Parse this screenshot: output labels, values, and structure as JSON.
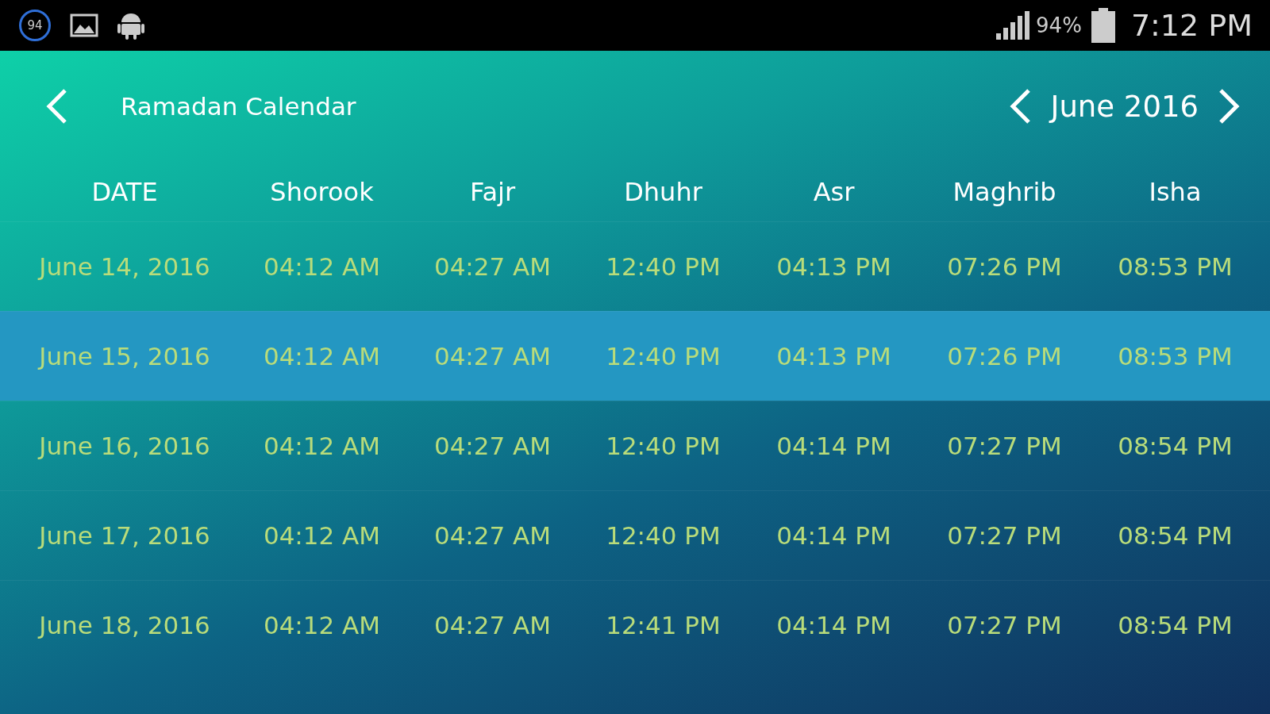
{
  "status_bar": {
    "notification_count": "94",
    "battery": "94%",
    "time": "7:12 PM"
  },
  "header": {
    "title": "Ramadan Calendar",
    "month": "June 2016"
  },
  "columns": [
    "DATE",
    "Shorook",
    "Fajr",
    "Dhuhr",
    "Asr",
    "Maghrib",
    "Isha"
  ],
  "rows": [
    {
      "selected": false,
      "cells": [
        "June 14, 2016",
        "04:12 AM",
        "04:27 AM",
        "12:40 PM",
        "04:13 PM",
        "07:26 PM",
        "08:53 PM"
      ]
    },
    {
      "selected": true,
      "cells": [
        "June 15, 2016",
        "04:12 AM",
        "04:27 AM",
        "12:40 PM",
        "04:13 PM",
        "07:26 PM",
        "08:53 PM"
      ]
    },
    {
      "selected": false,
      "cells": [
        "June 16, 2016",
        "04:12 AM",
        "04:27 AM",
        "12:40 PM",
        "04:14 PM",
        "07:27 PM",
        "08:54 PM"
      ]
    },
    {
      "selected": false,
      "cells": [
        "June 17, 2016",
        "04:12 AM",
        "04:27 AM",
        "12:40 PM",
        "04:14 PM",
        "07:27 PM",
        "08:54 PM"
      ]
    },
    {
      "selected": false,
      "cells": [
        "June 18, 2016",
        "04:12 AM",
        "04:27 AM",
        "12:41 PM",
        "04:14 PM",
        "07:27 PM",
        "08:54 PM"
      ]
    }
  ]
}
